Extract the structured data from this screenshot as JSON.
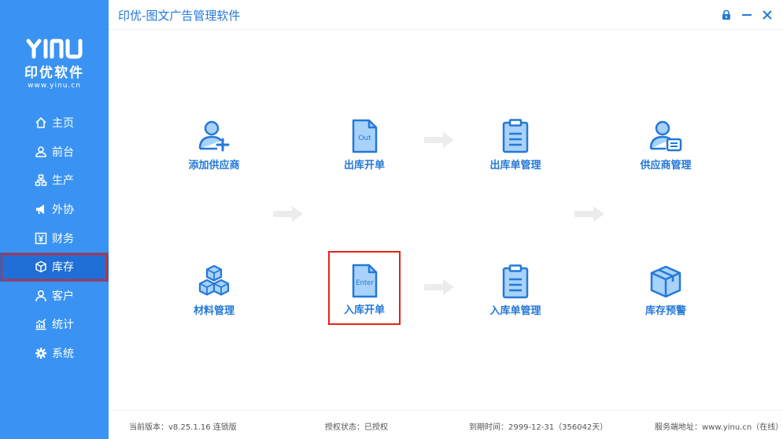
{
  "app": {
    "title": "印优-图文广告管理软件"
  },
  "logo": {
    "mark": "YINU",
    "name": "印优软件",
    "url": "www.yinu.cn"
  },
  "sidebar": {
    "items": [
      {
        "label": "主页",
        "icon": "home-icon"
      },
      {
        "label": "前台",
        "icon": "user-icon"
      },
      {
        "label": "生产",
        "icon": "org-icon"
      },
      {
        "label": "外协",
        "icon": "megaphone-icon"
      },
      {
        "label": "财务",
        "icon": "yen-icon"
      },
      {
        "label": "库存",
        "icon": "box-icon",
        "active": true
      },
      {
        "label": "客户",
        "icon": "person-icon"
      },
      {
        "label": "统计",
        "icon": "chart-icon"
      },
      {
        "label": "系统",
        "icon": "gear-icon"
      }
    ]
  },
  "tiles": {
    "add_supplier": {
      "label": "添加供应商",
      "icon": "add-user-icon"
    },
    "outbound_order": {
      "label": "出库开单",
      "icon": "out-document-icon",
      "badge": "Out"
    },
    "outbound_manage": {
      "label": "出库单管理",
      "icon": "clipboard-icon"
    },
    "supplier_manage": {
      "label": "供应商管理",
      "icon": "user-card-icon"
    },
    "material_manage": {
      "label": "材料管理",
      "icon": "boxes-icon"
    },
    "inbound_order": {
      "label": "入库开单",
      "icon": "enter-document-icon",
      "badge": "Enter"
    },
    "inbound_manage": {
      "label": "入库单管理",
      "icon": "clipboard-icon"
    },
    "stock_warning": {
      "label": "库存预警",
      "icon": "package-icon"
    }
  },
  "footer": {
    "version": "当前版本：v8.25.1.16  连锁版",
    "license": "授权状态：已授权",
    "expire": "到期时间：2999-12-31（356042天）",
    "server": "服务端地址：www.yinu.cn（在线）"
  },
  "colors": {
    "sidebar": "#3a93f2",
    "sidebar_active": "#1f6fd6",
    "accent": "#2478d8",
    "highlight": "#e8211f",
    "icon_fill": "#a8d2fa"
  }
}
